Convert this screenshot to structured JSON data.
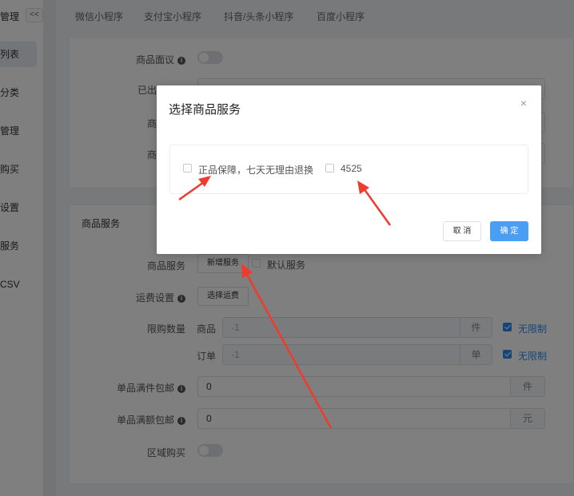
{
  "sidebar": {
    "title": "管理",
    "collapse_label": "<<",
    "items": [
      {
        "label": "列表",
        "active": true
      },
      {
        "label": "分类"
      },
      {
        "label": "管理"
      },
      {
        "label": "购买"
      },
      {
        "label": "设置"
      },
      {
        "label": "服务"
      },
      {
        "label": "CSV"
      }
    ]
  },
  "tabs": [
    "微信小程序",
    "支付宝小程序",
    "抖音/头条小程序",
    "百度小程序"
  ],
  "form": {
    "negotiable_label": "商品面议",
    "sold_label_partial": "已出",
    "row2_label": "商",
    "row3_label": "商"
  },
  "service_section": {
    "title": "商品服务",
    "service_label": "商品服务",
    "add_service_button": "新增服务",
    "default_service_label": "默认服务",
    "shipping_label": "运费设置",
    "choose_shipping_button": "选择运费",
    "limit_label": "限购数量",
    "limit_goods_label": "商品",
    "limit_goods_value": "-1",
    "limit_goods_unit": "件",
    "limit_goods_unlimited": "无限制",
    "limit_order_label": "订单",
    "limit_order_value": "-1",
    "limit_order_unit": "单",
    "limit_order_unlimited": "无限制",
    "free_qty_label": "单品满件包邮",
    "free_qty_value": "0",
    "free_qty_unit": "件",
    "free_amt_label": "单品满额包邮",
    "free_amt_value": "0",
    "free_amt_unit": "元",
    "region_label": "区域购买"
  },
  "modal": {
    "title": "选择商品服务",
    "close": "×",
    "options": [
      "正品保障，七天无理由退换",
      "4525"
    ],
    "cancel": "取 消",
    "ok": "确 定"
  },
  "colors": {
    "primary": "#4a9ff5",
    "arrow": "#f03a2e"
  }
}
